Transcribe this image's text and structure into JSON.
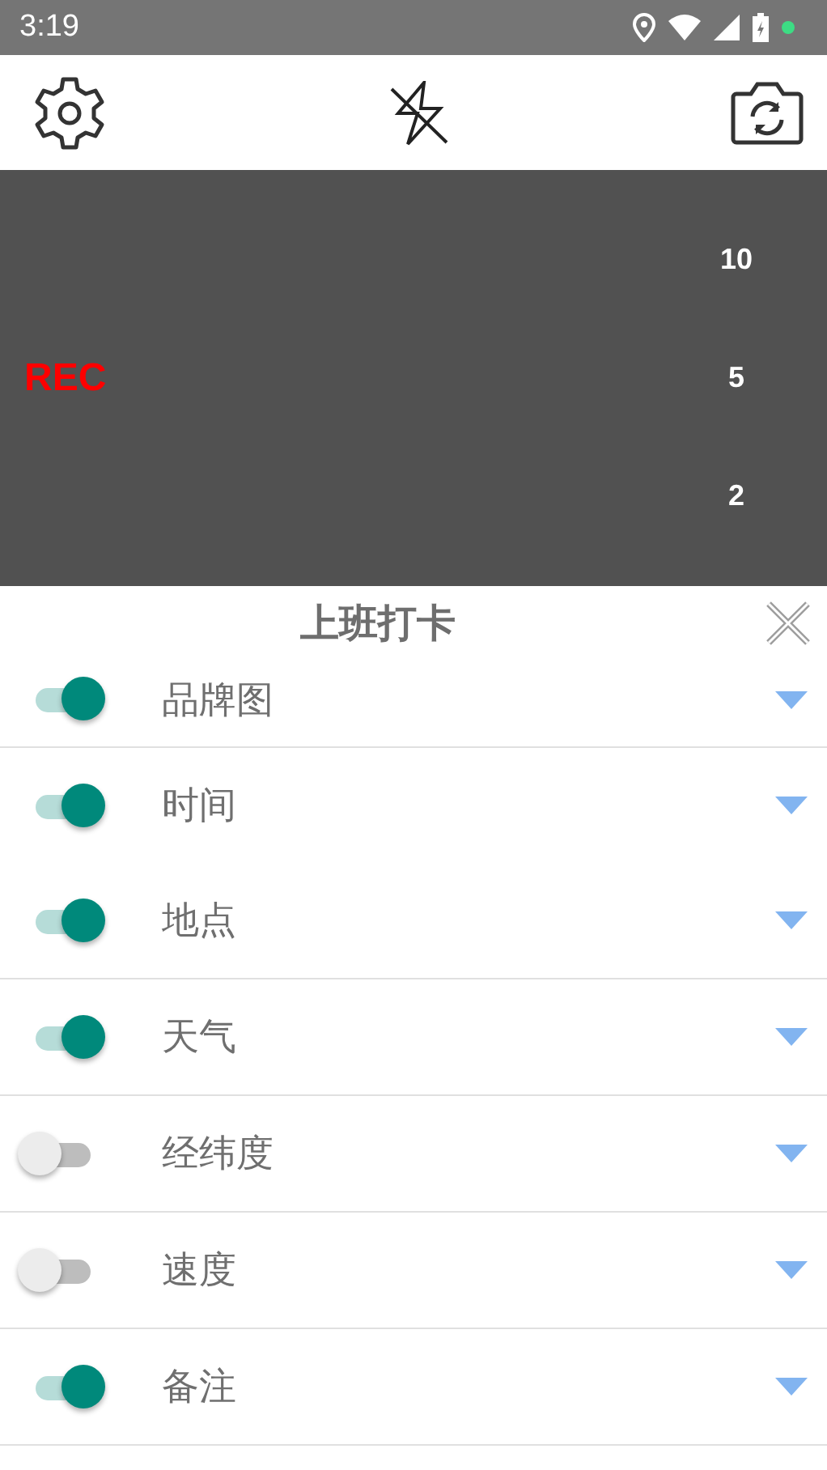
{
  "status_bar": {
    "time": "3:19"
  },
  "camera": {
    "recording_label": "REC",
    "zoom_levels": [
      "10",
      "5",
      "2"
    ]
  },
  "panel": {
    "title": "上班打卡",
    "rows": [
      {
        "label": "品牌图",
        "on": true,
        "divider": true
      },
      {
        "label": "时间",
        "on": true,
        "divider": false
      },
      {
        "label": "地点",
        "on": true,
        "divider": true
      },
      {
        "label": "天气",
        "on": true,
        "divider": true
      },
      {
        "label": "经纬度",
        "on": false,
        "divider": true
      },
      {
        "label": "速度",
        "on": false,
        "divider": true
      },
      {
        "label": "备注",
        "on": true,
        "divider": true
      }
    ]
  }
}
